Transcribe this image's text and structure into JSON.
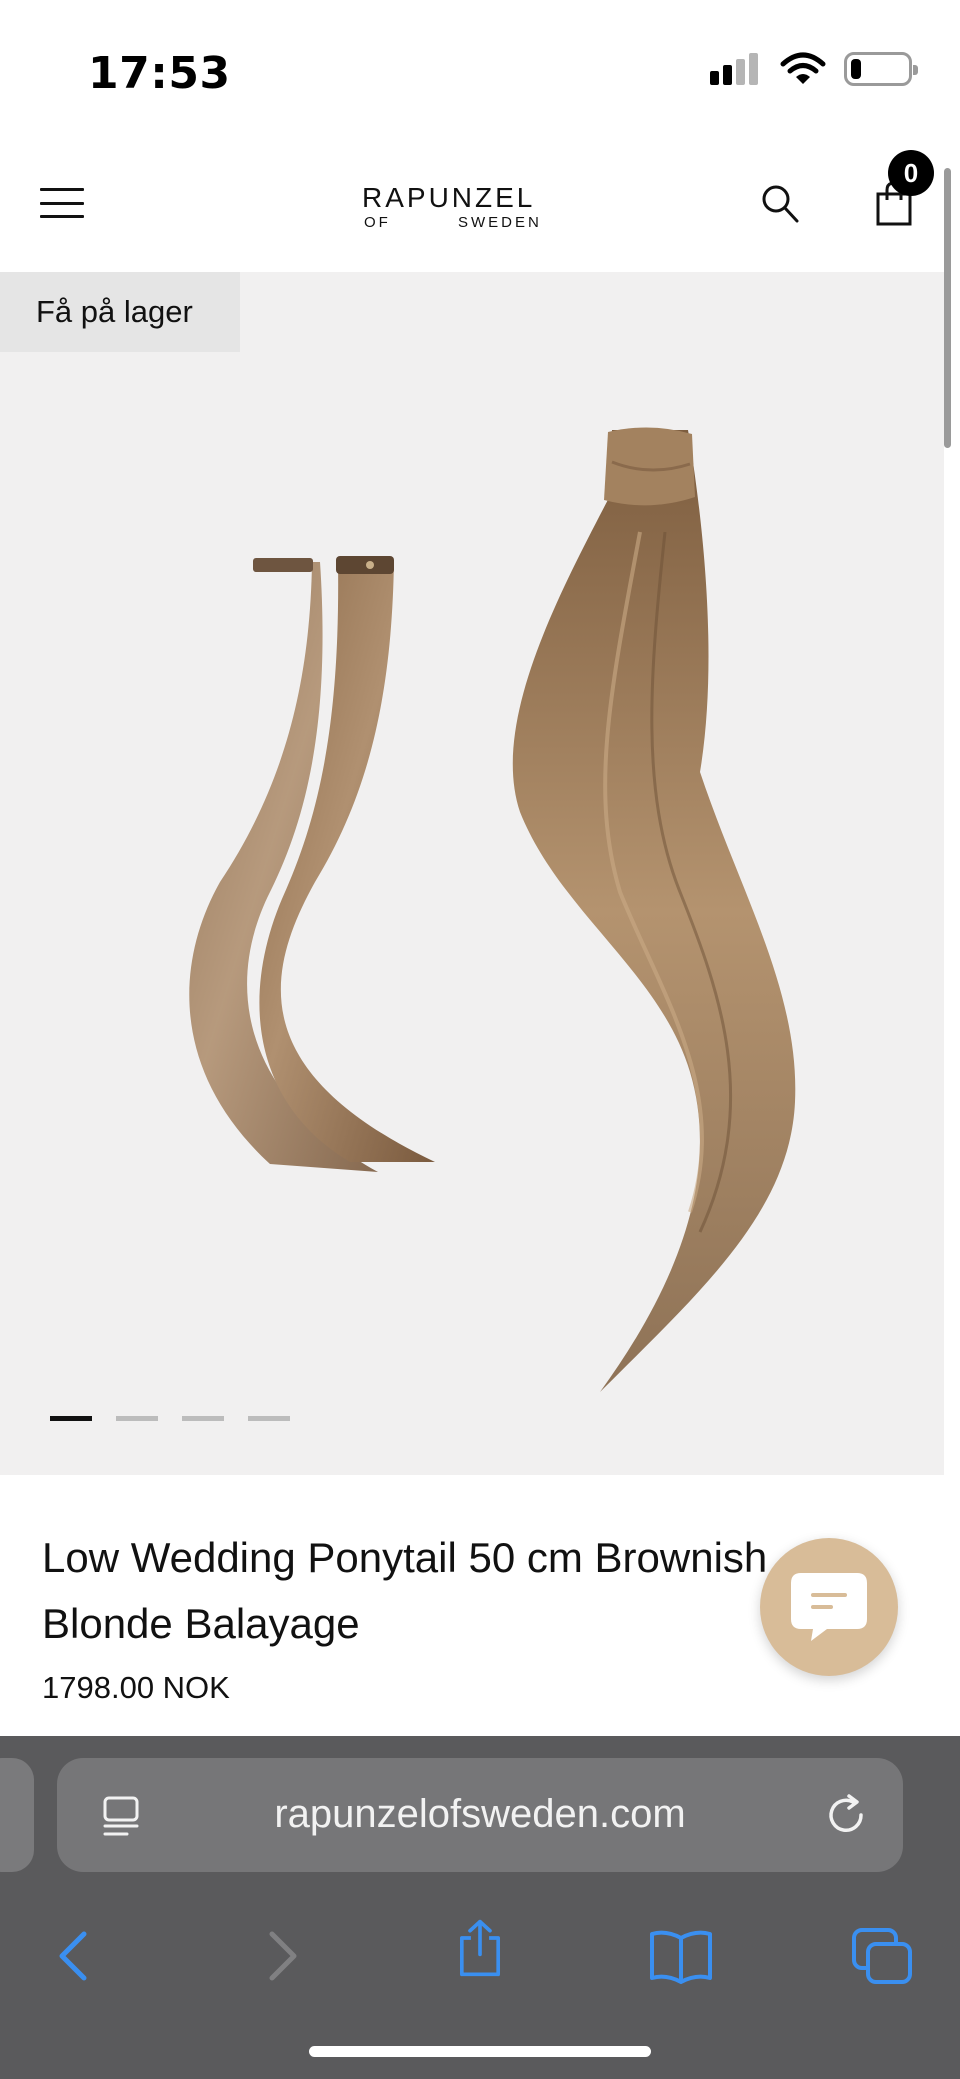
{
  "status_bar": {
    "time": "17:53",
    "signal_bars_filled": 2,
    "signal_bars_total": 4,
    "battery_level": 0.18
  },
  "header": {
    "logo_main": "RAPUNZEL",
    "logo_of": "OF",
    "logo_sweden": "SWEDEN",
    "cart_count": "0",
    "icons": [
      "menu-icon",
      "search-icon",
      "shopping-bag-icon"
    ]
  },
  "gallery": {
    "stock_badge": "Få på lager",
    "slide_count": 4,
    "active_slide": 1
  },
  "product": {
    "title": "Low Wedding Ponytail 50 cm Brownish Blonde Balayage",
    "price": "1798.00 NOK"
  },
  "browser": {
    "url": "rapunzelofsweden.com",
    "toolbar_icons": [
      "back-icon",
      "forward-icon",
      "share-icon",
      "bookmarks-icon",
      "tabs-icon"
    ]
  },
  "colors": {
    "accent_link": "#3a8ff0",
    "chat_button": "#d8bc98",
    "gallery_background": "#f1f0f0",
    "browser_chrome": "#5a5a5c"
  }
}
